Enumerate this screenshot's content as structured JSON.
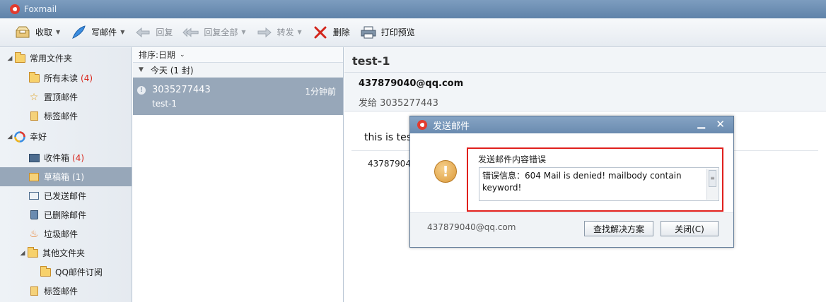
{
  "window": {
    "title": "Foxmail"
  },
  "toolbar": {
    "receive": "收取",
    "compose": "写邮件",
    "reply": "回复",
    "reply_all": "回复全部",
    "forward": "转发",
    "delete": "删除",
    "print_preview": "打印预览"
  },
  "sidebar": {
    "common_folders": "常用文件夹",
    "all_unread": "所有未读",
    "all_unread_count": "(4)",
    "pinned": "置顶邮件",
    "tagged": "标签邮件",
    "account": "幸好",
    "inbox": "收件箱",
    "inbox_count": "(4)",
    "drafts": "草稿箱",
    "drafts_count": "(1)",
    "sent": "已发送邮件",
    "deleted": "已删除邮件",
    "junk": "垃圾邮件",
    "other_folders": "其他文件夹",
    "qq_subscription": "QQ邮件订阅",
    "tagged2": "标签邮件"
  },
  "maillist": {
    "sort_label": "排序:日期",
    "group_label": "今天 (1 封)",
    "mail": {
      "sender": "3035277443",
      "time": "1分钟前",
      "subject": "test-1"
    }
  },
  "reader": {
    "subject": "test-1",
    "from": "437879040@qq.com",
    "to": "发给 3035277443",
    "body": "this is test",
    "signature": "437879040@qq.com"
  },
  "dialog": {
    "title": "发送邮件",
    "error_heading": "发送邮件内容错误",
    "error_message": "错误信息：604 Mail is denied! mailbody contain keyword!",
    "account": "437879040@qq.com",
    "find_solution": "查找解决方案",
    "close": "关闭(C)"
  },
  "colors": {
    "titlebar": "#6a8bb0",
    "selection": "#97a7b9",
    "error_border": "#e0201d",
    "unread_count": "#d9261c"
  }
}
